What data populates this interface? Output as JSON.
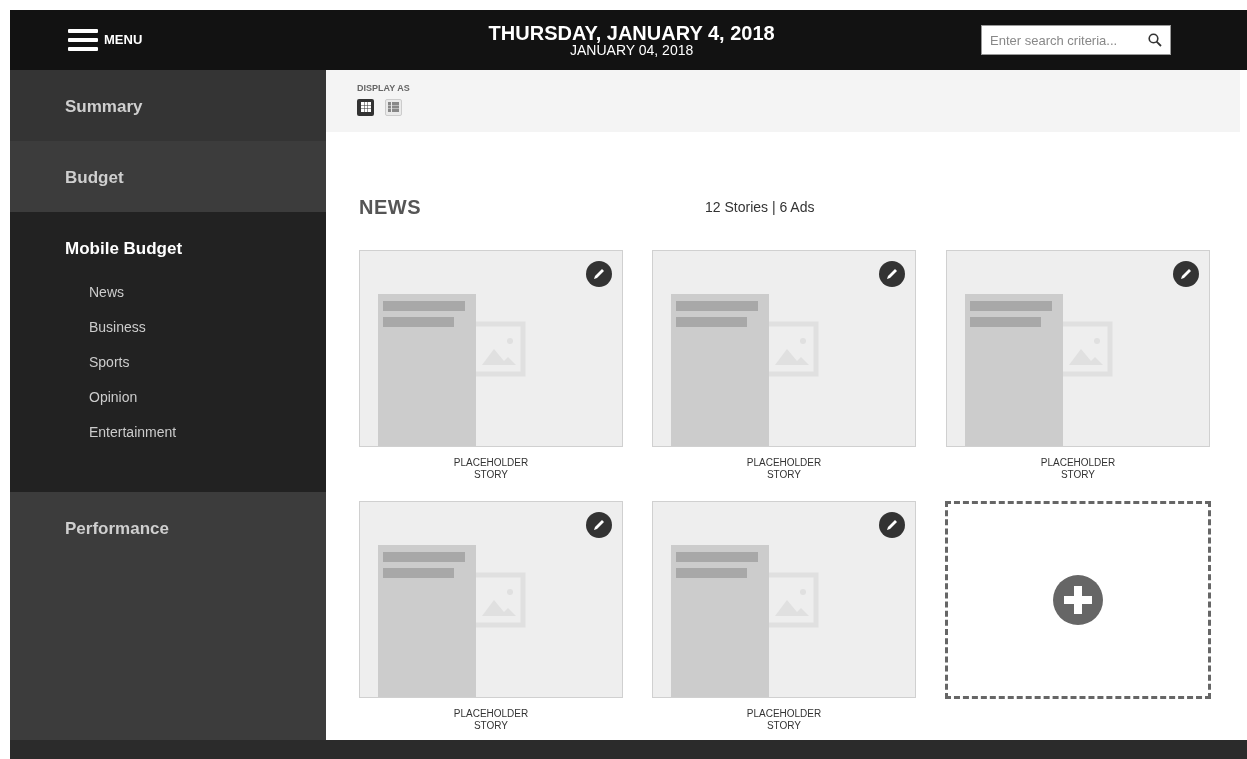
{
  "header": {
    "menu_label": "MENU",
    "title": "THURSDAY, JANUARY 4, 2018",
    "subtitle": "JANUARY 04, 2018",
    "search": {
      "placeholder": "Enter search criteria..."
    }
  },
  "sidebar": {
    "items": [
      {
        "label": "Summary",
        "selected": false
      },
      {
        "label": "Budget",
        "selected": false
      },
      {
        "label": "Mobile Budget",
        "selected": true,
        "children": [
          {
            "label": "News"
          },
          {
            "label": "Business"
          },
          {
            "label": "Sports"
          },
          {
            "label": "Opinion"
          },
          {
            "label": "Entertainment"
          }
        ]
      },
      {
        "label": "Performance",
        "selected": false
      }
    ]
  },
  "toolbar": {
    "label": "DISPLAY AS",
    "views": [
      {
        "kind": "grid",
        "selected": true
      },
      {
        "kind": "list",
        "selected": false
      }
    ]
  },
  "section": {
    "title": "NEWS",
    "summary": "12 Stories | 6 Ads"
  },
  "cards": [
    {
      "kind": "story",
      "caption": [
        "PLACEHOLDER",
        "STORY"
      ]
    },
    {
      "kind": "story",
      "caption": [
        "PLACEHOLDER",
        "STORY"
      ]
    },
    {
      "kind": "story",
      "caption": [
        "PLACEHOLDER",
        "STORY"
      ]
    },
    {
      "kind": "story",
      "caption": [
        "PLACEHOLDER",
        "STORY"
      ]
    },
    {
      "kind": "story",
      "caption": [
        "PLACEHOLDER",
        "STORY"
      ]
    },
    {
      "kind": "add"
    }
  ]
}
